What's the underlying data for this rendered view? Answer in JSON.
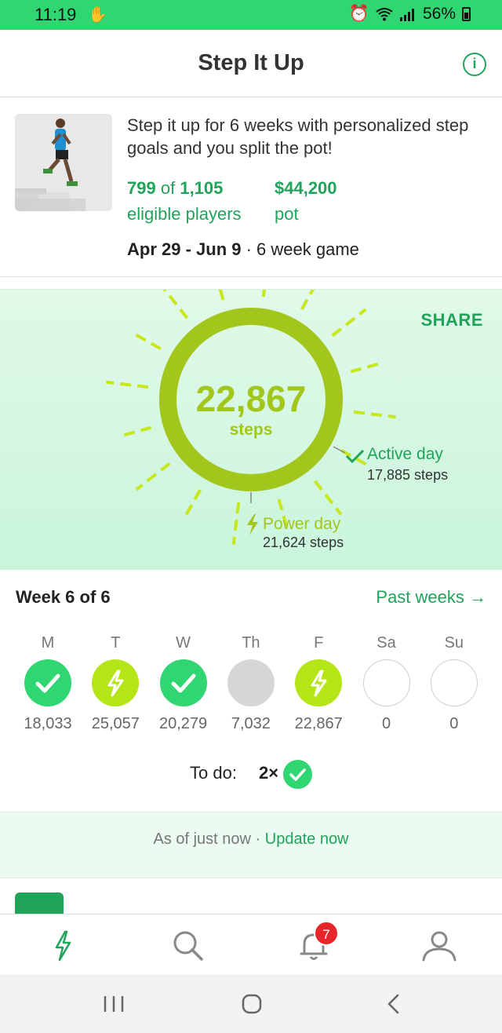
{
  "status": {
    "time": "11:19",
    "battery": "56%"
  },
  "header": {
    "title": "Step It Up",
    "info_icon": "info-icon"
  },
  "game": {
    "description": "Step it up for 6 weeks with personalized step goals and you split the pot!",
    "players_joined": "799",
    "players_of": "of",
    "players_total": "1,105",
    "players_label": "eligible players",
    "pot_amount": "$44,200",
    "pot_label": "pot",
    "dates": "Apr 29 - Jun 9",
    "duration": "6 week game"
  },
  "today": {
    "share_label": "SHARE",
    "steps": "22,867",
    "steps_label": "steps",
    "active_day_label": "Active day",
    "active_day_steps": "17,885 steps",
    "power_day_label": "Power day",
    "power_day_steps": "21,624 steps",
    "colors": {
      "ring": "#a3c61d",
      "rays": "#c8e61c",
      "active": "#2fd672"
    }
  },
  "week": {
    "title": "Week 6 of 6",
    "past_weeks": "Past weeks →",
    "days": [
      {
        "label": "M",
        "value": "18,033",
        "status": "active"
      },
      {
        "label": "T",
        "value": "25,057",
        "status": "power"
      },
      {
        "label": "W",
        "value": "20,279",
        "status": "active"
      },
      {
        "label": "Th",
        "value": "7,032",
        "status": "missed"
      },
      {
        "label": "F",
        "value": "22,867",
        "status": "power"
      },
      {
        "label": "Sa",
        "value": "0",
        "status": "upcoming"
      },
      {
        "label": "Su",
        "value": "0",
        "status": "upcoming"
      }
    ],
    "todo_label": "To do:",
    "todo_count": "2×"
  },
  "update": {
    "as_of": "As of just now · ",
    "update_link": "Update now"
  },
  "bottom_nav": {
    "items": [
      "games-bolt-icon",
      "search-icon",
      "notifications-bell-icon",
      "profile-icon"
    ],
    "notification_count": "7"
  },
  "system_nav": [
    "recents-icon",
    "home-icon",
    "back-icon"
  ]
}
